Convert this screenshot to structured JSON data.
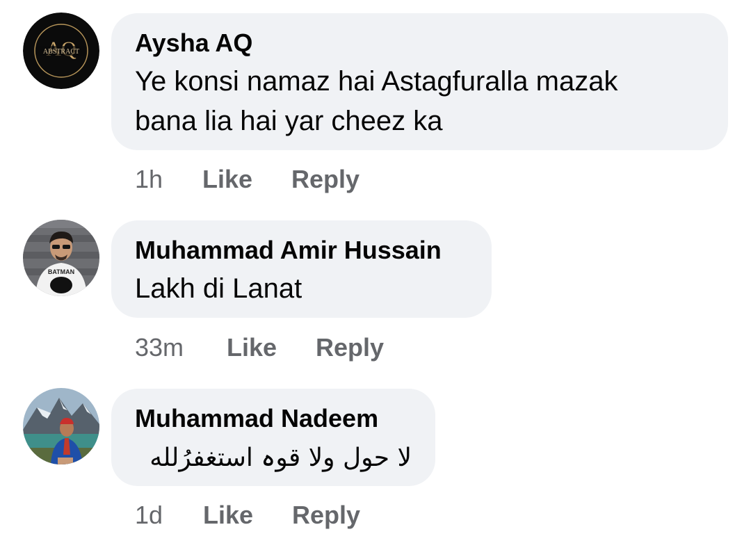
{
  "comments": [
    {
      "author": "Aysha AQ",
      "avatar_icon": "abstract-aq-logo-avatar",
      "avatar_logo_text": "AQ",
      "avatar_logo_subtext": "ABSTRACT",
      "text_line1": "Ye konsi namaz hai Astagfuralla mazak",
      "text_line2": "bana lia hai yar cheez ka",
      "time": "1h",
      "like_label": "Like",
      "reply_label": "Reply"
    },
    {
      "author": "Muhammad Amir Hussain",
      "avatar_icon": "user-photo-avatar",
      "avatar_shirt_text": "BATMAN",
      "text": "Lakh di Lanat",
      "time": "33m",
      "like_label": "Like",
      "reply_label": "Reply"
    },
    {
      "author": "Muhammad Nadeem",
      "avatar_icon": "user-photo-avatar",
      "text": "لا حول ولا قوہ استغفرُلله",
      "time": "1d",
      "like_label": "Like",
      "reply_label": "Reply"
    }
  ],
  "colors": {
    "bubble_bg": "#f0f2f5",
    "text": "#050505",
    "secondary_text": "#65676b"
  }
}
